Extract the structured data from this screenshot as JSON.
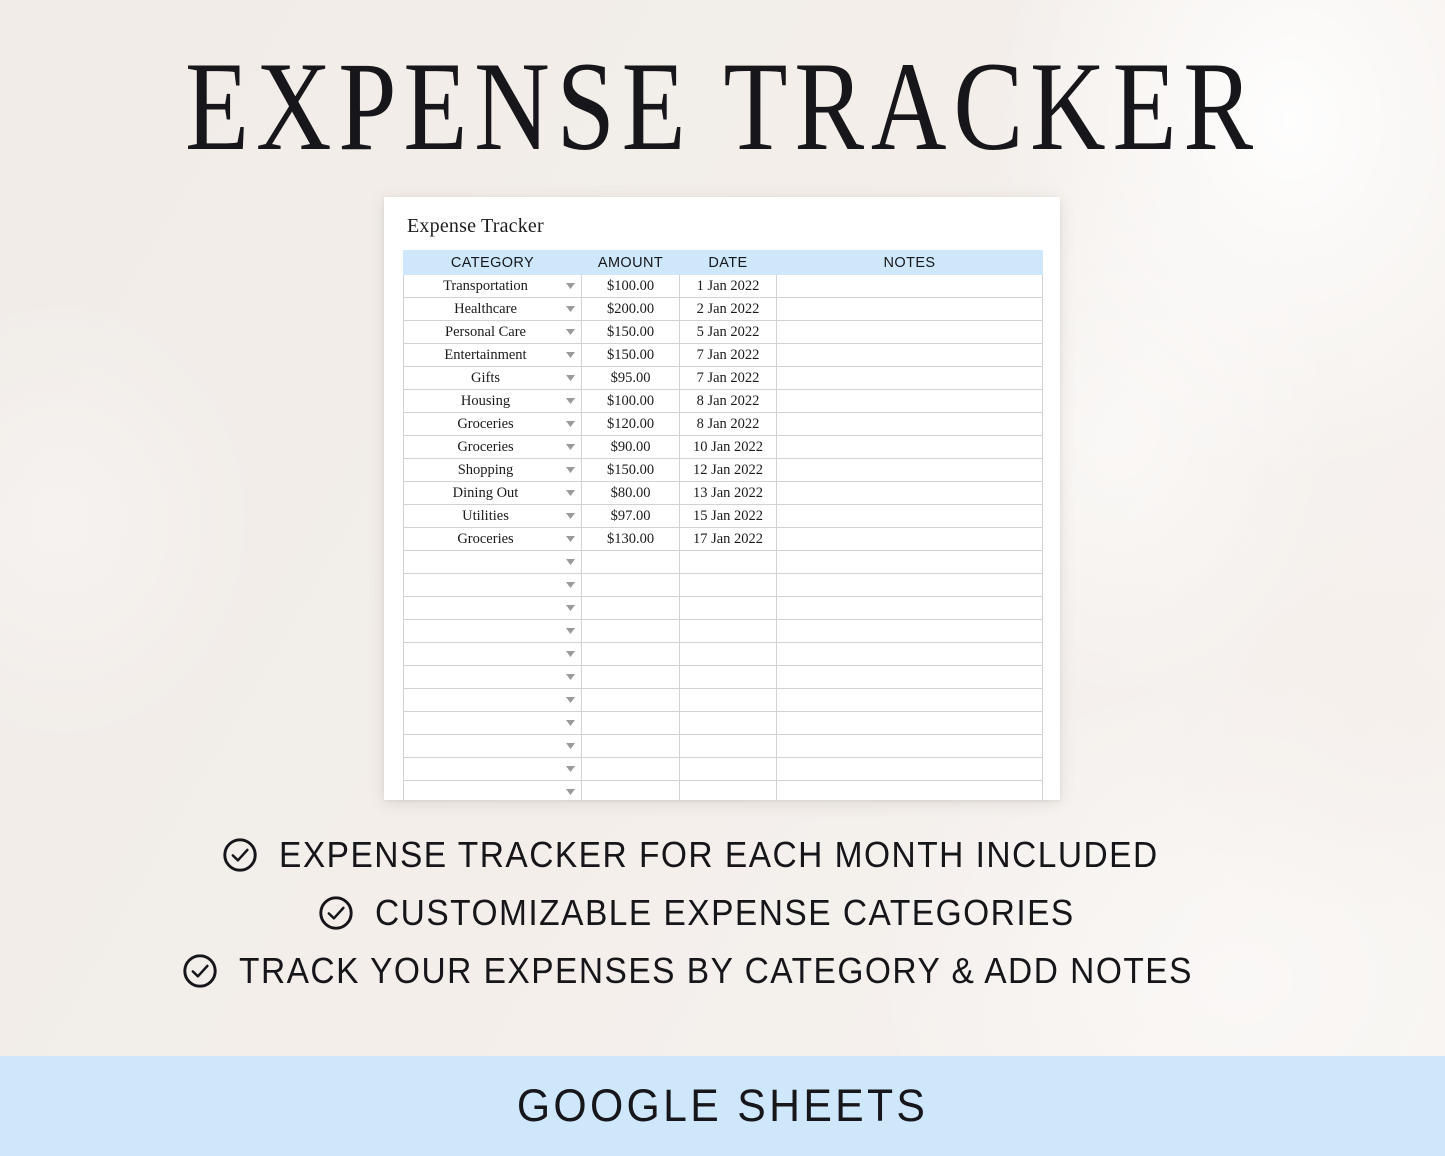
{
  "colors": {
    "background": "#f1ece8",
    "accent_blue": "#cee7fb",
    "text_dark": "#16161a",
    "card_white": "#ffffff",
    "grid_line": "#d2d2d2"
  },
  "header": {
    "title": "EXPENSE TRACKER"
  },
  "spreadsheet": {
    "sheet_label": "Expense Tracker",
    "columns": [
      "CATEGORY",
      "AMOUNT",
      "DATE",
      "NOTES"
    ],
    "rows": [
      {
        "category": "Transportation",
        "amount": "$100.00",
        "date": "1 Jan 2022",
        "notes": ""
      },
      {
        "category": "Healthcare",
        "amount": "$200.00",
        "date": "2 Jan 2022",
        "notes": ""
      },
      {
        "category": "Personal Care",
        "amount": "$150.00",
        "date": "5 Jan 2022",
        "notes": ""
      },
      {
        "category": "Entertainment",
        "amount": "$150.00",
        "date": "7 Jan 2022",
        "notes": ""
      },
      {
        "category": "Gifts",
        "amount": "$95.00",
        "date": "7 Jan 2022",
        "notes": ""
      },
      {
        "category": "Housing",
        "amount": "$100.00",
        "date": "8 Jan 2022",
        "notes": ""
      },
      {
        "category": "Groceries",
        "amount": "$120.00",
        "date": "8 Jan 2022",
        "notes": ""
      },
      {
        "category": "Groceries",
        "amount": "$90.00",
        "date": "10 Jan 2022",
        "notes": ""
      },
      {
        "category": "Shopping",
        "amount": "$150.00",
        "date": "12 Jan 2022",
        "notes": ""
      },
      {
        "category": "Dining Out",
        "amount": "$80.00",
        "date": "13 Jan 2022",
        "notes": ""
      },
      {
        "category": "Utilities",
        "amount": "$97.00",
        "date": "15 Jan 2022",
        "notes": ""
      },
      {
        "category": "Groceries",
        "amount": "$130.00",
        "date": "17 Jan 2022",
        "notes": ""
      },
      {
        "category": "",
        "amount": "",
        "date": "",
        "notes": ""
      },
      {
        "category": "",
        "amount": "",
        "date": "",
        "notes": ""
      },
      {
        "category": "",
        "amount": "",
        "date": "",
        "notes": ""
      },
      {
        "category": "",
        "amount": "",
        "date": "",
        "notes": ""
      },
      {
        "category": "",
        "amount": "",
        "date": "",
        "notes": ""
      },
      {
        "category": "",
        "amount": "",
        "date": "",
        "notes": ""
      },
      {
        "category": "",
        "amount": "",
        "date": "",
        "notes": ""
      },
      {
        "category": "",
        "amount": "",
        "date": "",
        "notes": ""
      },
      {
        "category": "",
        "amount": "",
        "date": "",
        "notes": ""
      },
      {
        "category": "",
        "amount": "",
        "date": "",
        "notes": ""
      },
      {
        "category": "",
        "amount": "",
        "date": "",
        "notes": ""
      },
      {
        "category": "",
        "amount": "",
        "date": "",
        "notes": ""
      }
    ],
    "dropdown_icon": "caret-down-icon"
  },
  "features": {
    "bullet_icon": "circle-check-icon",
    "items": [
      "EXPENSE TRACKER FOR EACH MONTH INCLUDED",
      "CUSTOMIZABLE EXPENSE CATEGORIES",
      "TRACK YOUR EXPENSES BY CATEGORY & ADD NOTES"
    ]
  },
  "footer": {
    "label": "GOOGLE SHEETS"
  }
}
